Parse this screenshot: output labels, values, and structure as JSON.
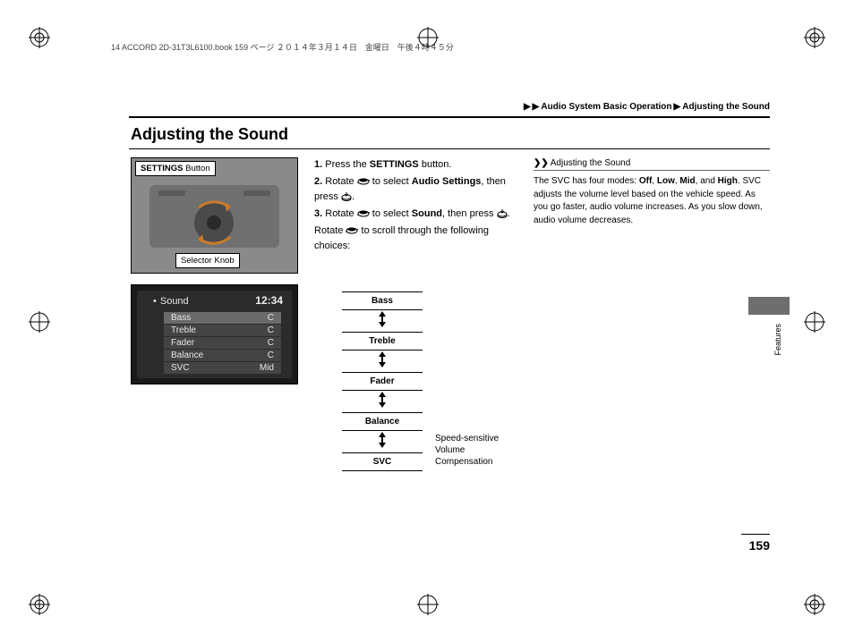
{
  "runhead": "14 ACCORD 2D-31T3L6100.book  159 ページ  ２０１４年３月１４日　金曜日　午後４時４５分",
  "breadcrumb": {
    "a": "Audio System Basic Operation",
    "b": "Adjusting the Sound"
  },
  "title": "Adjusting the Sound",
  "callouts": {
    "settings_bold": "SETTINGS",
    "settings_rest": " Button",
    "selector": "Selector Knob"
  },
  "screen": {
    "time": "12:34",
    "title": "Sound",
    "rows": [
      {
        "label": "Bass",
        "val": "C"
      },
      {
        "label": "Treble",
        "val": "C"
      },
      {
        "label": "Fader",
        "val": "C"
      },
      {
        "label": "Balance",
        "val": "C"
      },
      {
        "label": "SVC",
        "val": "Mid"
      }
    ]
  },
  "steps": {
    "s1a": "1.",
    "s1b": " Press the ",
    "s1c": "SETTINGS",
    "s1d": " button.",
    "s2a": "2.",
    "s2b": " Rotate ",
    "s2c": " to select ",
    "s2d": "Audio Settings",
    "s2e": ", then press ",
    "s2f": ".",
    "s3a": "3.",
    "s3b": " Rotate ",
    "s3c": " to select ",
    "s3d": "Sound",
    "s3e": ", then press ",
    "s3f": ".",
    "followA": "Rotate ",
    "followB": " to scroll through the following choices:"
  },
  "flow": {
    "items": [
      "Bass",
      "Treble",
      "Fader",
      "Balance",
      "SVC"
    ]
  },
  "svc_caption": "Speed-sensitive Volume Compensation",
  "sidebar": {
    "head": "Adjusting the Sound",
    "t1": "The SVC has four modes: ",
    "m1": "Off",
    "c": ", ",
    "m2": "Low",
    "m3": "Mid",
    "and": ", and ",
    "m4": "High",
    "t2": ". SVC adjusts the volume level based on the vehicle speed. As you go faster, audio volume increases. As you slow down, audio volume decreases."
  },
  "tab": "Features",
  "pagenum": "159"
}
